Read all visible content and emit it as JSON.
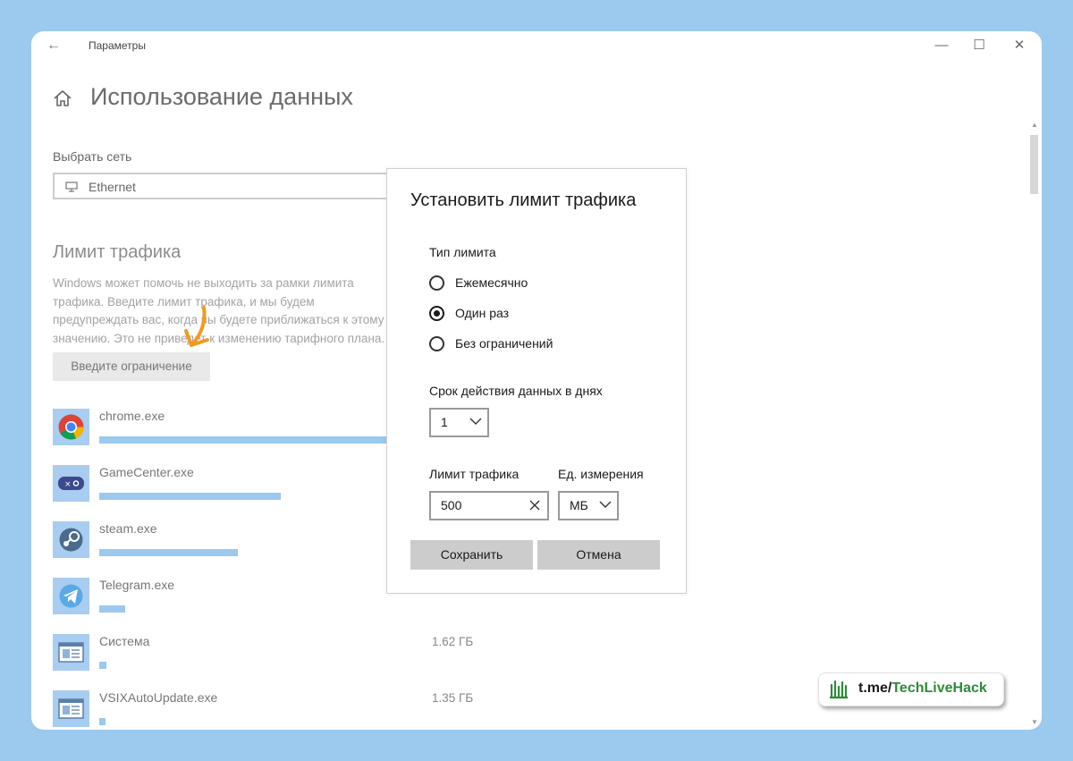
{
  "window": {
    "title": "Параметры"
  },
  "page": {
    "title": "Использование данных"
  },
  "network": {
    "label": "Выбрать сеть",
    "selected": "Ethernet",
    "icon": "ethernet-monitor-icon"
  },
  "limit": {
    "heading": "Лимит трафика",
    "description": "Windows может помочь не выходить за рамки лимита трафика. Введите лимит трафика, и мы будем предупреждать вас, когда вы будете приближаться к этому значению. Это не приведет к изменению тарифного плана.",
    "button_label": "Введите ограничение"
  },
  "apps": [
    {
      "name": "chrome.exe",
      "size": "",
      "usage_fraction": 1.0,
      "icon": "chrome-icon"
    },
    {
      "name": "GameCenter.exe",
      "size": "",
      "usage_fraction": 0.63,
      "icon": "gamecenter-icon"
    },
    {
      "name": "steam.exe",
      "size": "",
      "usage_fraction": 0.48,
      "icon": "steam-icon"
    },
    {
      "name": "Telegram.exe",
      "size": "",
      "usage_fraction": 0.09,
      "icon": "telegram-icon"
    },
    {
      "name": "Система",
      "size": "1.62 ГБ",
      "usage_fraction": 0.025,
      "icon": "system-window-icon"
    },
    {
      "name": "VSIXAutoUpdate.exe",
      "size": "1.35 ГБ",
      "usage_fraction": 0.022,
      "icon": "system-window-icon"
    }
  ],
  "dialog": {
    "title": "Установить лимит трафика",
    "limit_type_label": "Тип лимита",
    "options": [
      {
        "label": "Ежемесячно",
        "checked": false
      },
      {
        "label": "Один раз",
        "checked": true
      },
      {
        "label": "Без ограничений",
        "checked": false
      }
    ],
    "days_label": "Срок действия данных в днях",
    "days_value": "1",
    "traffic_label": "Лимит трафика",
    "traffic_value": "500",
    "unit_label": "Ед. измерения",
    "unit_value": "МБ",
    "save_label": "Сохранить",
    "cancel_label": "Отмена"
  },
  "watermark": {
    "prefix": "t.me/",
    "name": "TechLiveHack"
  },
  "colors": {
    "background": "#9cc9ee",
    "usage_bar": "#9cc9ee",
    "dialog_button": "#cccccc",
    "watermark_green": "#2e8a3a"
  }
}
